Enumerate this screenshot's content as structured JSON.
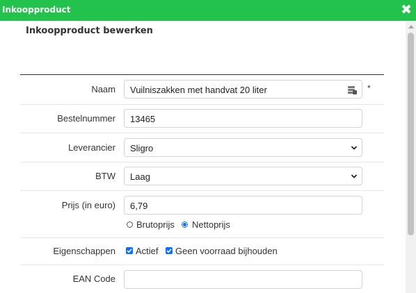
{
  "window": {
    "title": "Inkoopproduct",
    "close_icon": "close-icon"
  },
  "form": {
    "heading": "Inkoopproduct bewerken",
    "naam": {
      "label": "Naam",
      "value": "Vuilniszakken met handvat 20 liter",
      "required_marker": "*",
      "icon": "database-icon"
    },
    "bestelnummer": {
      "label": "Bestelnummer",
      "value": "13465"
    },
    "leverancier": {
      "label": "Leverancier",
      "value": "Sligro"
    },
    "btw": {
      "label": "BTW",
      "value": "Laag"
    },
    "prijs": {
      "label": "Prijs (in euro)",
      "value": "6,79",
      "options": [
        {
          "label": "Brutoprijs",
          "selected": false
        },
        {
          "label": "Nettoprijs",
          "selected": true
        }
      ]
    },
    "eigenschappen": {
      "label": "Eigenschappen",
      "options": [
        {
          "label": "Actief",
          "checked": true
        },
        {
          "label": "Geen voorraad bijhouden",
          "checked": true
        }
      ]
    },
    "ean": {
      "label": "EAN Code",
      "value": ""
    }
  },
  "colors": {
    "titlebar": "#22c24c",
    "accent": "#0d6efd"
  }
}
